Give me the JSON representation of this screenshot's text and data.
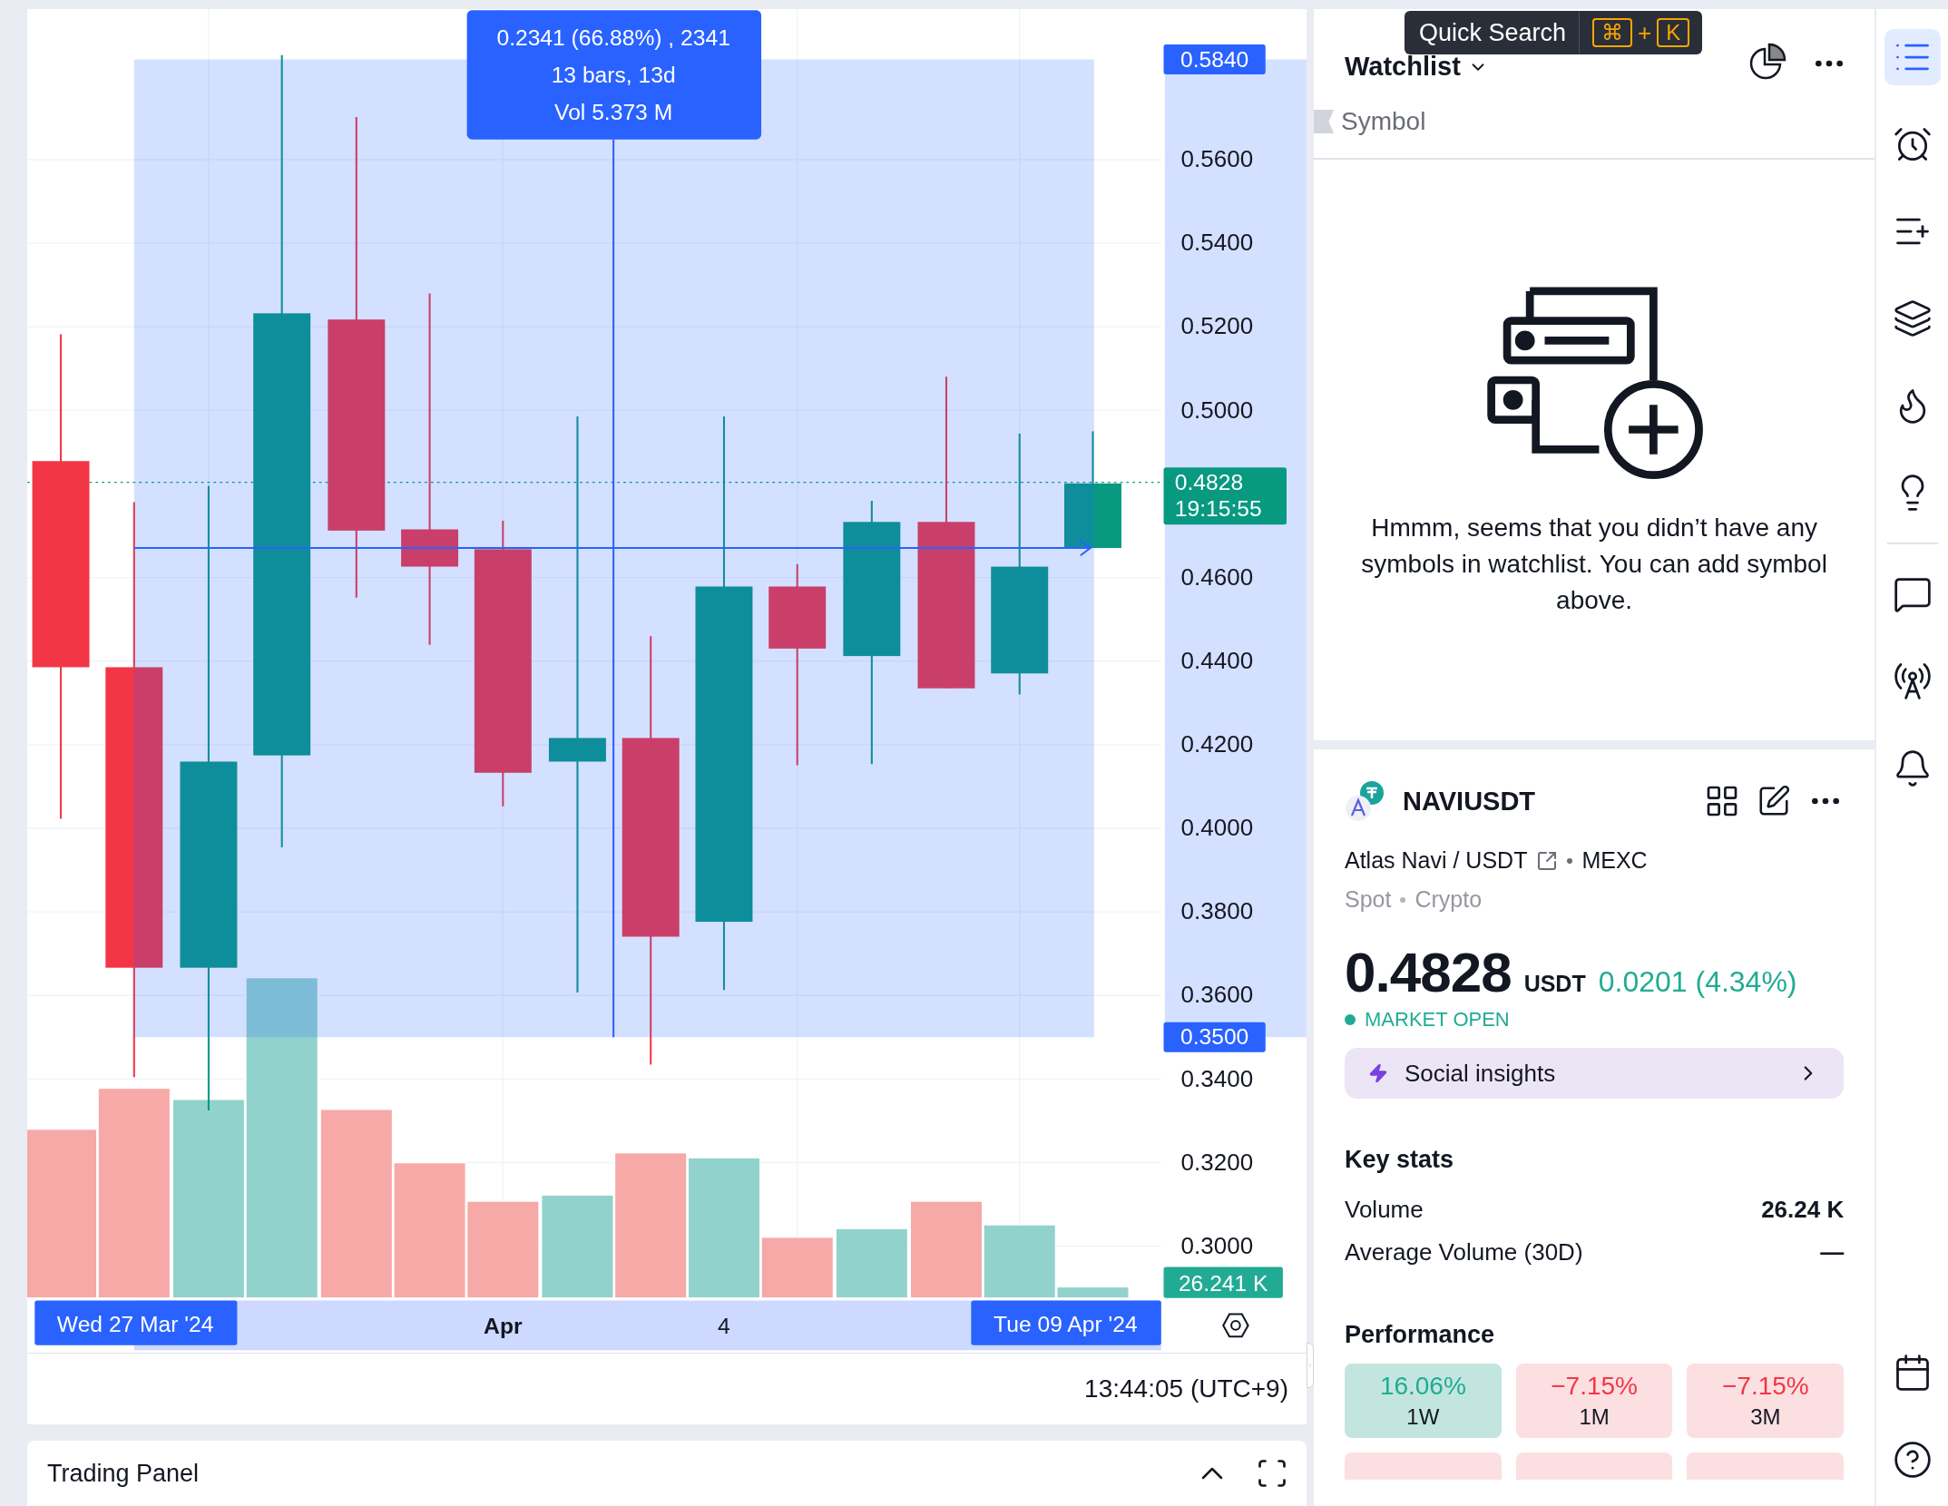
{
  "chart": {
    "measure_tooltip": [
      "0.2341 (66.88%) , 2341",
      "13 bars, 13d",
      "Vol 5.373 M"
    ],
    "price_ticks": [
      "0.5600",
      "0.5400",
      "0.5200",
      "0.5000",
      "0.4600",
      "0.4400",
      "0.4200",
      "0.4000",
      "0.3800",
      "0.3600",
      "0.3400",
      "0.3200",
      "0.3000"
    ],
    "range_high": "0.5840",
    "range_low": "0.3500",
    "last_price": {
      "price": "0.4828",
      "countdown": "19:15:55"
    },
    "volume_label": "26.241 K",
    "time_start": "Wed 27 Mar '24",
    "time_ticks": [
      {
        "label": "Apr",
        "bold": true
      },
      {
        "label": "4",
        "bold": false
      }
    ],
    "time_end": "Tue 09 Apr '24",
    "clock": "13:44:05 (UTC+9)"
  },
  "trading_panel": {
    "title": "Trading Panel"
  },
  "quick_search": {
    "label": "Quick Search",
    "keys": [
      "⌘",
      "K"
    ],
    "joiner": "+"
  },
  "watchlist": {
    "title": "Watchlist",
    "column": "Symbol",
    "empty_message": "Hmmm, seems that you didn’t have any symbols in watchlist. You can add symbol above."
  },
  "symbol": {
    "ticker": "NAVIUSDT",
    "name": "Atlas Navi / USDT",
    "exchange": "MEXC",
    "tags": [
      "Spot",
      "Crypto"
    ],
    "price": "0.4828",
    "currency": "USDT",
    "change": "0.0201 (4.34%)",
    "change_positive": true,
    "market_status": "MARKET OPEN",
    "social_button": "Social insights"
  },
  "key_stats": {
    "title": "Key stats",
    "rows": [
      {
        "label": "Volume",
        "value": "26.24 K"
      },
      {
        "label": "Average Volume (30D)",
        "value": "—"
      }
    ]
  },
  "performance": {
    "title": "Performance",
    "tiles": [
      {
        "value": "16.06%",
        "period": "1W",
        "positive": true
      },
      {
        "value": "−7.15%",
        "period": "1M",
        "positive": false
      },
      {
        "value": "−7.15%",
        "period": "3M",
        "positive": false
      }
    ],
    "cut_tiles": [
      {
        "positive": false
      },
      {
        "positive": false
      },
      {
        "positive": false
      }
    ]
  },
  "sidebar": {
    "top": [
      {
        "kind": "watchlist",
        "selected": true
      },
      {
        "kind": "alarm",
        "selected": false
      },
      {
        "kind": "add-list",
        "selected": false
      },
      {
        "kind": "layers",
        "selected": false
      },
      {
        "kind": "flame",
        "selected": false
      },
      {
        "kind": "bulb",
        "selected": false
      }
    ],
    "middle": [
      {
        "kind": "chat",
        "selected": false
      },
      {
        "kind": "broadcast",
        "selected": false
      },
      {
        "kind": "bell",
        "selected": false
      }
    ],
    "bottom": [
      {
        "kind": "calendar",
        "selected": false
      },
      {
        "kind": "help",
        "selected": false
      }
    ]
  }
}
